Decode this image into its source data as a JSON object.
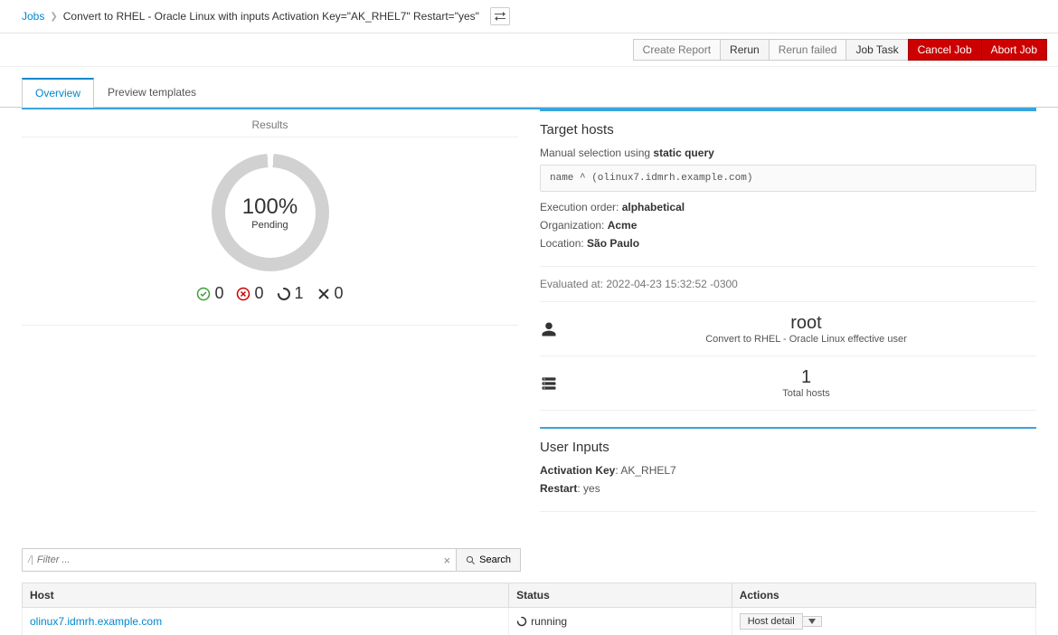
{
  "breadcrumb": {
    "root": "Jobs",
    "title": "Convert to RHEL - Oracle Linux with inputs Activation Key=\"AK_RHEL7\" Restart=\"yes\""
  },
  "actions": {
    "create_report": "Create Report",
    "rerun": "Rerun",
    "rerun_failed": "Rerun failed",
    "job_task": "Job Task",
    "cancel_job": "Cancel Job",
    "abort_job": "Abort Job"
  },
  "tabs": {
    "overview": "Overview",
    "preview": "Preview templates"
  },
  "results": {
    "heading": "Results",
    "pct": "100%",
    "status": "Pending",
    "success": "0",
    "failed": "0",
    "pending": "1",
    "cancelled": "0"
  },
  "target": {
    "heading": "Target hosts",
    "selection_prefix": "Manual selection using ",
    "selection_strong": "static query",
    "query": "name ^ (olinux7.idmrh.example.com)",
    "exec_order_lbl": "Execution order: ",
    "exec_order_val": "alphabetical",
    "org_lbl": "Organization: ",
    "org_val": "Acme",
    "loc_lbl": "Location: ",
    "loc_val": "São Paulo",
    "evaluated": "Evaluated at: 2022-04-23 15:32:52 -0300"
  },
  "effective_user": {
    "value": "root",
    "caption": "Convert to RHEL - Oracle Linux effective user"
  },
  "total_hosts": {
    "value": "1",
    "caption": "Total hosts"
  },
  "user_inputs": {
    "heading": "User Inputs",
    "activation_key_lbl": "Activation Key",
    "activation_key_val": ": AK_RHEL7",
    "restart_lbl": "Restart",
    "restart_val": ": yes"
  },
  "filter": {
    "placeholder": "Filter ...",
    "search_label": "Search"
  },
  "table": {
    "col_host": "Host",
    "col_status": "Status",
    "col_actions": "Actions",
    "row_host": "olinux7.idmrh.example.com",
    "row_status": "running",
    "row_action": "Host detail"
  }
}
